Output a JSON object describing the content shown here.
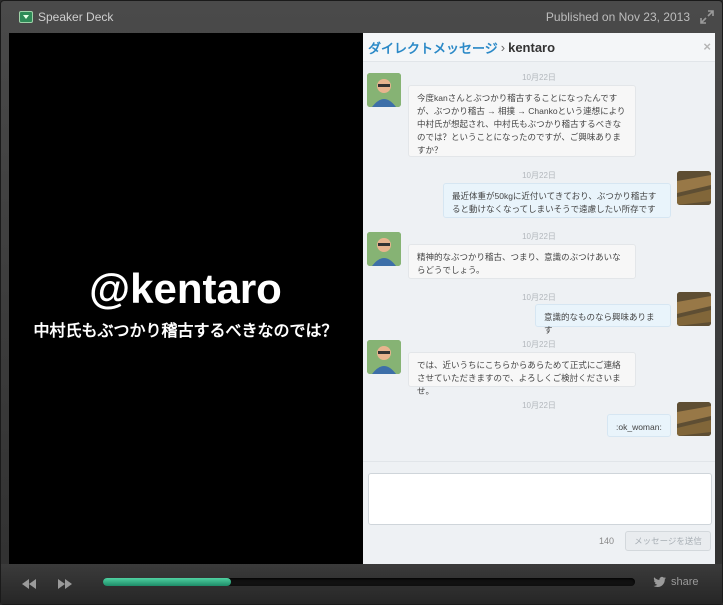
{
  "topbar": {
    "brand": "Speaker Deck",
    "published": "Published on Nov 23, 2013",
    "brand_icon": "speakerdeck-icon",
    "expand_icon": "expand-icon"
  },
  "slide": {
    "handle": "@kentaro",
    "question": "中村氏もぶつかり稽古するべきなのでは？"
  },
  "dm": {
    "header_link": "ダイレクトメッセージ",
    "header_sep": "›",
    "header_user": "kentaro",
    "close": "×",
    "messages": [
      {
        "date": "10月22日",
        "from": "kentaro",
        "text": "今度kanさんとぶつかり稽古することになったんですが、ぶつかり稽古 → 相撲 → Chankoという連想により中村氏が想起され、中村氏もぶつかり稽古するべきなのでは？ということになったのですが、ご興味ありますか？"
      },
      {
        "date": "10月22日",
        "from": "me",
        "text": "最近体重が50kgに近付いてきており、ぶつかり稽古すると動けなくなってしまいそうで遠慮したい所存です"
      },
      {
        "date": "10月22日",
        "from": "kentaro",
        "text": "精神的なぶつかり稽古、つまり、意識のぶつけあいならどうでしょう。"
      },
      {
        "date": "10月22日",
        "from": "me",
        "text": "意識的なものなら興味あります"
      },
      {
        "date": "10月22日",
        "from": "kentaro",
        "text": "では、近いうちにこちらからあらためて正式にご連絡させていただきますので、よろしくご検討くださいませ。"
      },
      {
        "date": "10月22日",
        "from": "me",
        "text": ":ok_woman:"
      }
    ],
    "char_count": "140",
    "send_label": "メッセージを送信"
  },
  "controls": {
    "progress": 0.24,
    "share_label": "share",
    "accent": "#2fb37f"
  }
}
